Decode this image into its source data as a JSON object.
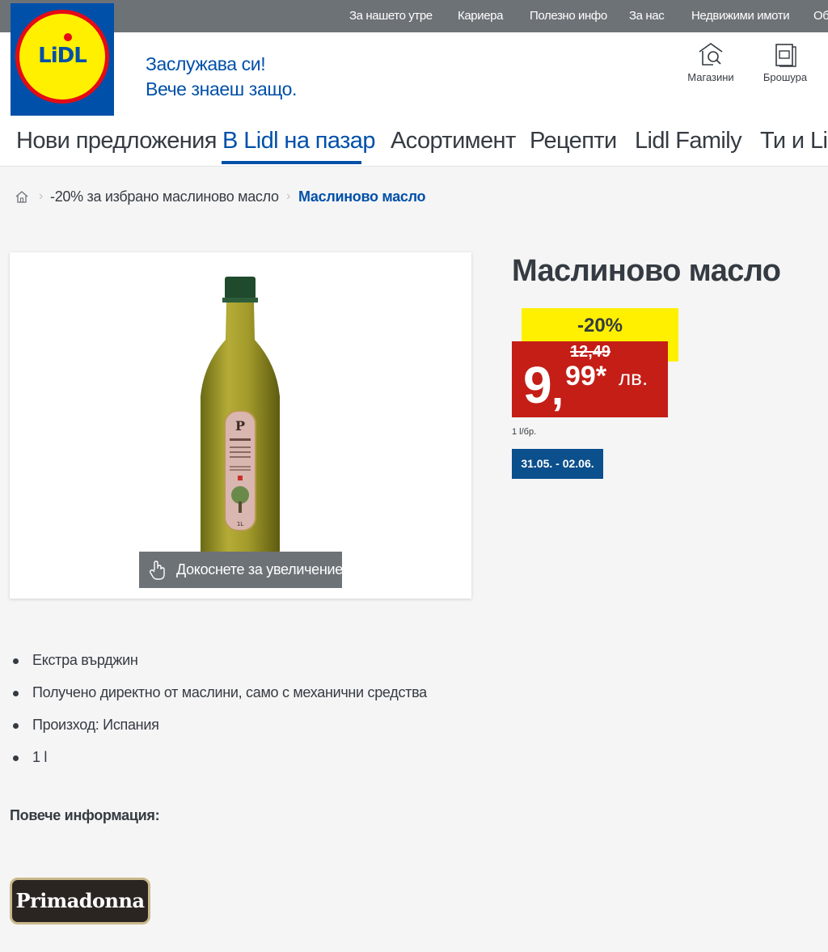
{
  "topbar": {
    "links": [
      "За нашето утре",
      "Кариера",
      "Полезно инфо",
      "За нас",
      "Недвижими имоти",
      "Об"
    ]
  },
  "header": {
    "logo_text": "LiDL",
    "slogan_line1": "Заслужава си!",
    "slogan_line2": "Вече знаеш защо.",
    "stores_label": "Магазини",
    "brochure_label": "Брошура"
  },
  "nav": {
    "items": [
      "Нови предложения",
      "В Lidl на пазар",
      "Асортимент",
      "Рецепти",
      "Lidl Family",
      "Ти и Lid"
    ],
    "active_index": 1
  },
  "breadcrumb": {
    "items": [
      "-20% за избрано маслиново масло",
      "Маслиново масло"
    ]
  },
  "product": {
    "title": "Маслиново масло",
    "discount": "-20%",
    "old_price": "12,49",
    "price_whole": "9",
    "price_cents": "99*",
    "currency": "лв.",
    "unit": "1 l/бр.",
    "date_range": "31.05. - 02.06.",
    "zoom_hint": "Докоснете за увеличение",
    "bottle_label_size": "1L"
  },
  "features": [
    "Екстра върджин",
    "Получено директно от маслини, само с механични средства",
    "Произход: Испания",
    "1 l"
  ],
  "more_info_label": "Повече информация:",
  "brand": {
    "name": "Primadonna"
  },
  "colors": {
    "brand_blue": "#0050aa",
    "topbar_gray": "#6d7277",
    "discount_yellow": "#fff000",
    "price_red": "#c41e17",
    "date_blue": "#0b4f8c"
  }
}
